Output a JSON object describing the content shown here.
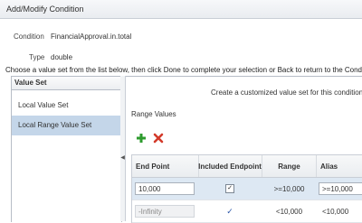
{
  "dialog": {
    "title": "Add/Modify Condition"
  },
  "condition": {
    "condition_label": "Condition",
    "condition_value": "FinancialApproval.in.total",
    "type_label": "Type",
    "type_value": "double"
  },
  "instruction": "Choose a value set from the list below, then click Done to complete your selection or Back to return to the Conditi",
  "value_set_panel": {
    "header": "Value Set",
    "items": [
      {
        "label": "Local Value Set",
        "selected": false
      },
      {
        "label": "Local Range Value Set",
        "selected": true
      }
    ]
  },
  "right_panel": {
    "create_text": "Create a customized value set for this condition",
    "range_values_label": "Range Values",
    "add_icon": "plus-icon",
    "delete_icon": "x-icon",
    "columns": {
      "end_point": "End Point",
      "included_endpoint": "Included Endpoint",
      "range": "Range",
      "alias": "Alias"
    },
    "rows": [
      {
        "end_point": "10,000",
        "included": true,
        "range": ">=10,000",
        "alias": ">=10,000",
        "editable": true
      },
      {
        "end_point": "-Infinity",
        "included": true,
        "range": "<10,000",
        "alias": "<10,000",
        "editable": false
      }
    ]
  },
  "colors": {
    "selection": "#c4d6e9",
    "add_icon": "#2e9b2e",
    "delete_icon": "#d33a2a"
  }
}
